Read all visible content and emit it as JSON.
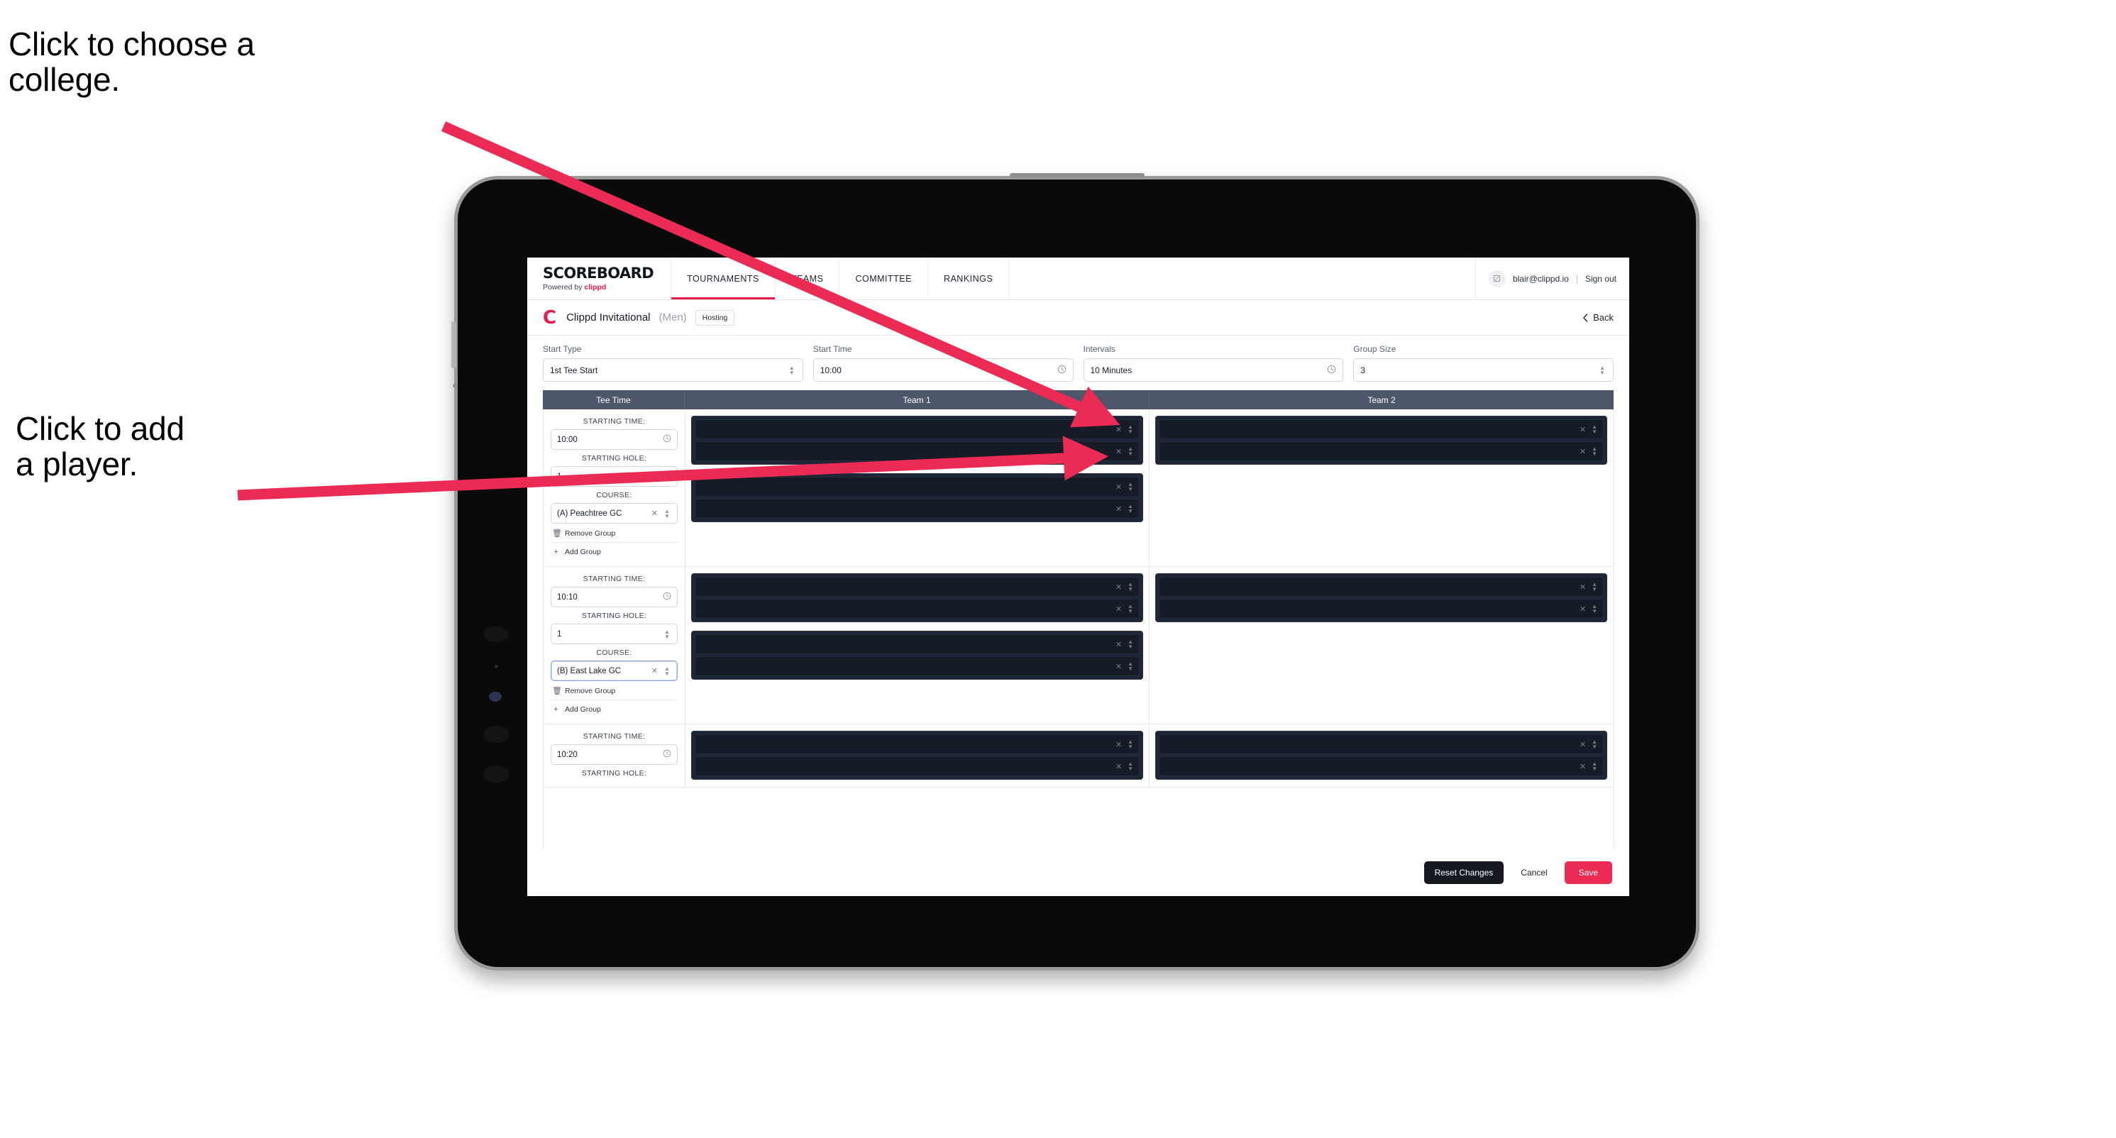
{
  "annotations": {
    "college": "Click to choose a\ncollege.",
    "player": "Click to add\na player."
  },
  "colors": {
    "accent": "#e8194b",
    "save": "#ec2b55",
    "table_header": "#4d566b",
    "player_row": "#151b27",
    "subgroup": "#1e2636"
  },
  "nav": {
    "brand_word": "SCOREBOARD",
    "brand_sub_prefix": "Powered by ",
    "brand_sub_name": "clippd",
    "tabs": [
      {
        "label": "TOURNAMENTS",
        "active": true
      },
      {
        "label": "TEAMS",
        "active": false
      },
      {
        "label": "COMMITTEE",
        "active": false
      },
      {
        "label": "RANKINGS",
        "active": false
      }
    ],
    "account": {
      "avatar_icon": "user-icon",
      "email": "blair@clippd.io",
      "separator": "|",
      "sign_out": "Sign out"
    }
  },
  "tournament_bar": {
    "logo_letter": "C",
    "name": "Clippd Invitational",
    "gender": "(Men)",
    "badge": "Hosting",
    "back_icon": "chevron-left-icon",
    "back_label": "Back"
  },
  "settings": {
    "fields": [
      {
        "label": "Start Type",
        "value": "1st Tee Start",
        "icon": "chevron-updown-icon"
      },
      {
        "label": "Start Time",
        "value": "10:00",
        "icon": "clock-icon"
      },
      {
        "label": "Intervals",
        "value": "10 Minutes",
        "icon": "clock-icon"
      },
      {
        "label": "Group Size",
        "value": "3",
        "icon": "chevron-updown-icon"
      }
    ]
  },
  "table": {
    "headers": [
      "Tee Time",
      "Team 1",
      "Team 2"
    ],
    "labels": {
      "starting_time": "STARTING TIME:",
      "starting_hole": "STARTING HOLE:",
      "course": "COURSE:",
      "remove_group": "Remove Group",
      "add_group": "Add Group",
      "remove_icon": "trash-icon",
      "add_icon": "plus-icon",
      "clear_icon": "close-icon",
      "clock_icon": "clock-icon",
      "spin_icon": "chevron-updown-icon"
    },
    "groups": [
      {
        "starting_time": "10:00",
        "starting_hole": "1",
        "course": "(A) Peachtree GC",
        "course_focused": false,
        "team1_subgroups": [
          2,
          2
        ],
        "team2_subgroups": [
          2
        ]
      },
      {
        "starting_time": "10:10",
        "starting_hole": "1",
        "course": "(B) East Lake GC",
        "course_focused": true,
        "team1_subgroups": [
          2,
          2
        ],
        "team2_subgroups": [
          2
        ]
      },
      {
        "starting_time": "10:20",
        "starting_hole": "",
        "course": "",
        "course_focused": false,
        "team1_subgroups": [
          2
        ],
        "team2_subgroups": [
          2
        ]
      }
    ]
  },
  "footer": {
    "reset": "Reset Changes",
    "cancel": "Cancel",
    "save": "Save"
  }
}
